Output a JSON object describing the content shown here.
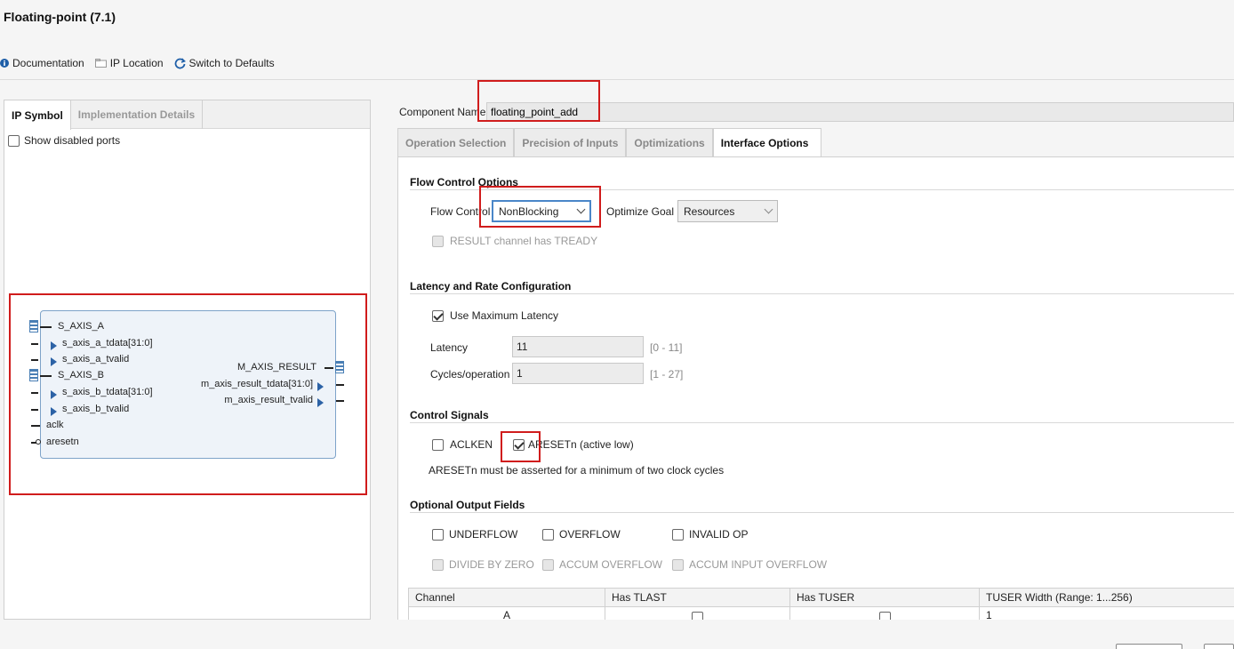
{
  "window": {
    "title": "Floating-point (7.1)"
  },
  "toolbar": {
    "documentation": "Documentation",
    "ip_location": "IP Location",
    "switch_defaults": "Switch to Defaults"
  },
  "left": {
    "tabs": [
      "IP Symbol",
      "Implementation Details"
    ],
    "show_disabled_ports": "Show disabled ports",
    "symbol": {
      "inputs": [
        {
          "label": "S_AXIS_A",
          "kind": "bus"
        },
        {
          "label": "s_axis_a_tdata[31:0]",
          "kind": "sub"
        },
        {
          "label": "s_axis_a_tvalid",
          "kind": "sub"
        },
        {
          "label": "S_AXIS_B",
          "kind": "bus"
        },
        {
          "label": "s_axis_b_tdata[31:0]",
          "kind": "sub"
        },
        {
          "label": "s_axis_b_tvalid",
          "kind": "sub"
        },
        {
          "label": "aclk",
          "kind": "clk"
        },
        {
          "label": "aresetn",
          "kind": "rst"
        }
      ],
      "outputs": [
        {
          "label": "M_AXIS_RESULT",
          "kind": "bus"
        },
        {
          "label": "m_axis_result_tdata[31:0]",
          "kind": "sub"
        },
        {
          "label": "m_axis_result_tvalid",
          "kind": "sub"
        }
      ]
    }
  },
  "right": {
    "component_name_label": "Component Name",
    "component_name_value": "floating_point_add",
    "tabs": [
      "Operation Selection",
      "Precision of Inputs",
      "Optimizations",
      "Interface Options"
    ],
    "active_tab": "Interface Options",
    "flow": {
      "section": "Flow Control Options",
      "flow_control_label": "Flow Control",
      "flow_control_value": "NonBlocking",
      "optimize_goal_label": "Optimize Goal",
      "optimize_goal_value": "Resources",
      "result_tready": "RESULT channel has TREADY"
    },
    "latency": {
      "section": "Latency and Rate Configuration",
      "use_max": "Use Maximum Latency",
      "latency_label": "Latency",
      "latency_value": "11",
      "latency_range": "[0 - 11]",
      "cycles_label": "Cycles/operation",
      "cycles_value": "1",
      "cycles_range": "[1 - 27]"
    },
    "control": {
      "section": "Control Signals",
      "aclken": "ACLKEN",
      "aresetn": "ARESETn (active low)",
      "note": "ARESETn must be asserted for a minimum of two clock cycles"
    },
    "optional": {
      "section": "Optional Output Fields",
      "underflow": "UNDERFLOW",
      "overflow": "OVERFLOW",
      "invalid_op": "INVALID OP",
      "divide_by_zero": "DIVIDE BY ZERO",
      "accum_overflow": "ACCUM OVERFLOW",
      "accum_input_overflow": "ACCUM INPUT OVERFLOW"
    },
    "table": {
      "headers": [
        "Channel",
        "Has TLAST",
        "Has TUSER",
        "TUSER Width (Range: 1...256)"
      ],
      "row": {
        "channel": "A",
        "tuser_width": "1"
      }
    }
  }
}
